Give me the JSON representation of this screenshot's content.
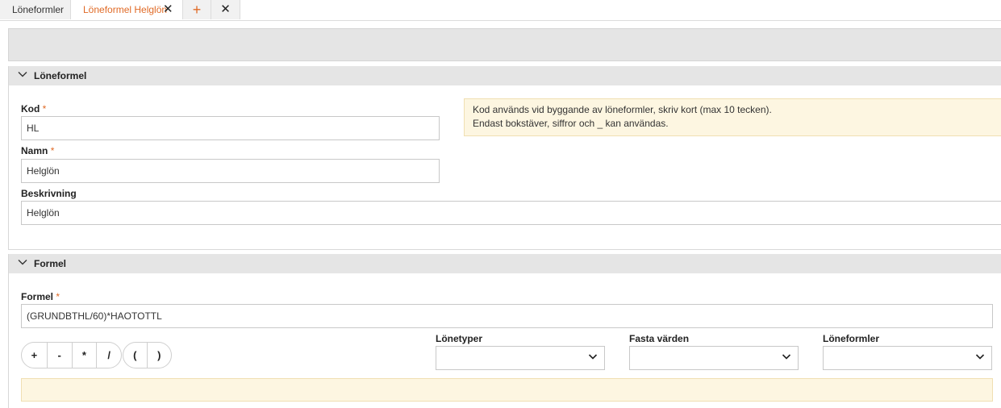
{
  "tabs": [
    {
      "label": "Löneformler"
    },
    {
      "label": "Löneformel Helglön"
    }
  ],
  "tab_add_icon": "+",
  "tab_close_icon": "✕",
  "sections": {
    "loneformel": {
      "title": "Löneformel",
      "kod_label": "Kod",
      "kod_value": "HL",
      "namn_label": "Namn",
      "namn_value": "Helglön",
      "beskrivning_label": "Beskrivning",
      "beskrivning_value": "Helglön",
      "info_line1": "Kod används vid byggande av löneformler, skriv kort (max 10 tecken).",
      "info_line2": "Endast bokstäver, siffror och _ kan användas."
    },
    "formel": {
      "title": "Formel",
      "formel_label": "Formel",
      "formel_value": "(GRUNDBTHL/60)*HAOTOTTL",
      "operators": [
        "+",
        "-",
        "*",
        "/"
      ],
      "parens": [
        "(",
        ")"
      ],
      "lonetyper_label": "Lönetyper",
      "fasta_varden_label": "Fasta värden",
      "loneformler_label": "Löneformler"
    }
  },
  "required_marker": "*",
  "colors": {
    "accent": "#e06a26",
    "info_bg": "#fdf6e1",
    "header_bg": "#e5e5e5"
  }
}
